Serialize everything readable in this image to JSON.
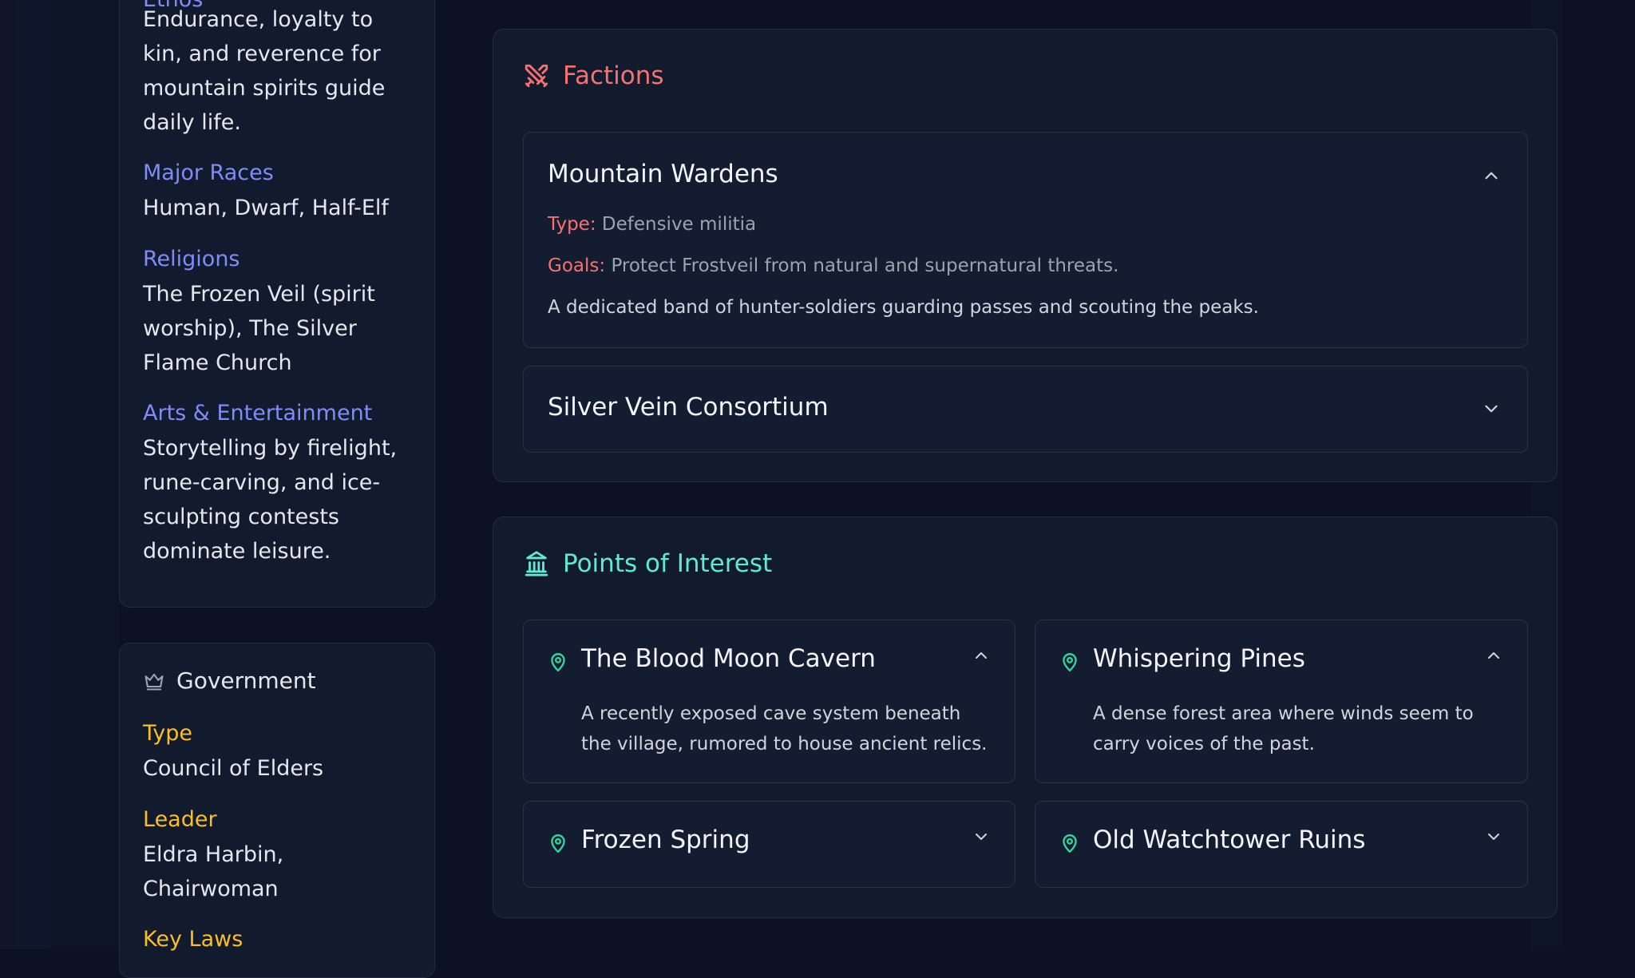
{
  "culture": {
    "ethos_label": "Ethos",
    "ethos_value": "Endurance, loyalty to kin, and reverence for mountain spirits guide daily life.",
    "races_label": "Major Races",
    "races_value": "Human, Dwarf, Half-Elf",
    "religions_label": "Religions",
    "religions_value": "The Frozen Veil (spirit worship), The Silver Flame Church",
    "arts_label": "Arts & Entertainment",
    "arts_value": "Storytelling by firelight, rune-carving, and ice-sculpting contests dominate leisure."
  },
  "government": {
    "title": "Government",
    "icon": "crown-icon",
    "type_label": "Type",
    "type_value": "Council of Elders",
    "leader_label": "Leader",
    "leader_value": "Eldra Harbin, Chairwoman",
    "laws_label": "Key Laws"
  },
  "factions": {
    "title": "Factions",
    "icon": "crossed-swords-icon",
    "accent": "#f87171",
    "items": [
      {
        "name": "Mountain Wardens",
        "expanded": true,
        "type_label": "Type:",
        "type_value": "Defensive militia",
        "goals_label": "Goals:",
        "goals_value": "Protect Frostveil from natural and supernatural threats.",
        "description": "A dedicated band of hunter-soldiers guarding passes and scouting the peaks."
      },
      {
        "name": "Silver Vein Consortium",
        "expanded": false
      }
    ]
  },
  "poi": {
    "title": "Points of Interest",
    "icon": "landmark-icon",
    "accent": "#5eead4",
    "items": [
      {
        "name": "The Blood Moon Cavern",
        "expanded": true,
        "description": "A recently exposed cave system beneath the village, rumored to house ancient relics."
      },
      {
        "name": "Whispering Pines",
        "expanded": true,
        "description": "A dense forest area where winds seem to carry voices of the past."
      },
      {
        "name": "Frozen Spring",
        "expanded": false
      },
      {
        "name": "Old Watchtower Ruins",
        "expanded": false
      }
    ]
  }
}
